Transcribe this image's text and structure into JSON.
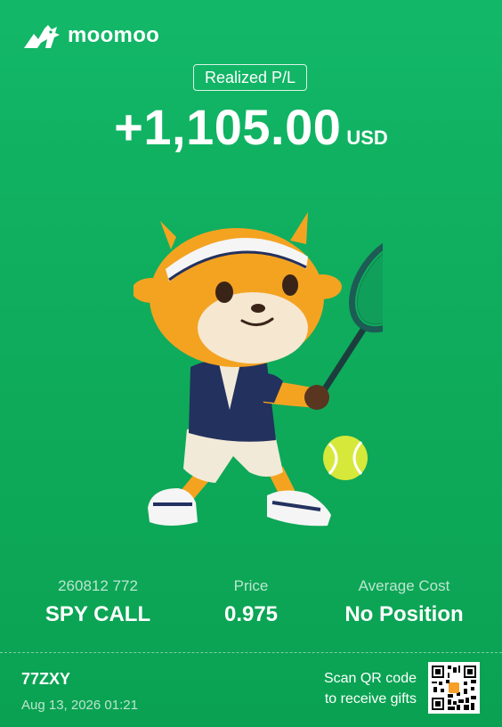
{
  "brand": {
    "name": "moomoo",
    "logo_icon": "bull-logo-icon"
  },
  "pl": {
    "label": "Realized P/L",
    "amount": "+1,105.00",
    "currency": "USD"
  },
  "mascot": {
    "icon": "bull-tennis-player-illustration"
  },
  "stats": [
    {
      "label": "260812 772",
      "value": "SPY CALL"
    },
    {
      "label": "Price",
      "value": "0.975"
    },
    {
      "label": "Average Cost",
      "value": "No Position"
    }
  ],
  "footer": {
    "user_id": "77ZXY",
    "timestamp": "Aug 13, 2026 01:21",
    "qr_line1": "Scan QR code",
    "qr_line2": "to receive gifts",
    "qr_icon": "qr-code-icon"
  },
  "colors": {
    "background": "#0fad5d",
    "text": "#ffffff",
    "mascot_orange": "#f5a623",
    "shirt_navy": "#23315e",
    "tennis_ball": "#d6e83a"
  }
}
